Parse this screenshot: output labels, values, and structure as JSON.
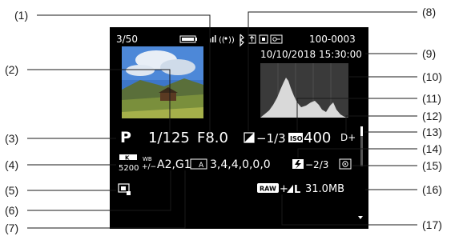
{
  "callouts": [
    "(1)",
    "(2)",
    "(3)",
    "(4)",
    "(5)",
    "(6)",
    "(7)",
    "(8)",
    "(9)",
    "(10)",
    "(11)",
    "(12)",
    "(13)",
    "(14)",
    "(15)",
    "(16)",
    "(17)"
  ],
  "screen": {
    "image_index": "3/50",
    "folder_file": "100-0003",
    "datetime": "10/10/2018 15:30:00",
    "mode": "P",
    "shutter": "1/125",
    "aperture": "F8.0",
    "exposure_comp": "−1/3",
    "iso_label": "ISO",
    "iso_value": "400",
    "dplus": "D+",
    "wb_kelvin_label": "K",
    "wb_kelvin": "5200",
    "wb_label_top": "WB",
    "wb_shift": "A2,G1",
    "picture_style_values": "3,4,4,0,0,0",
    "flash_comp": "−2/3",
    "quality": "+",
    "quality_raw": "RAW",
    "quality_jpeg": "L",
    "file_size": "31.0MB",
    "style_icon_text": "A"
  },
  "colors": {
    "screen_bg": "#000000",
    "text": "#ffffff",
    "histogram_fill": "#d9d9d9",
    "histogram_bg": "#3a3a3a"
  }
}
